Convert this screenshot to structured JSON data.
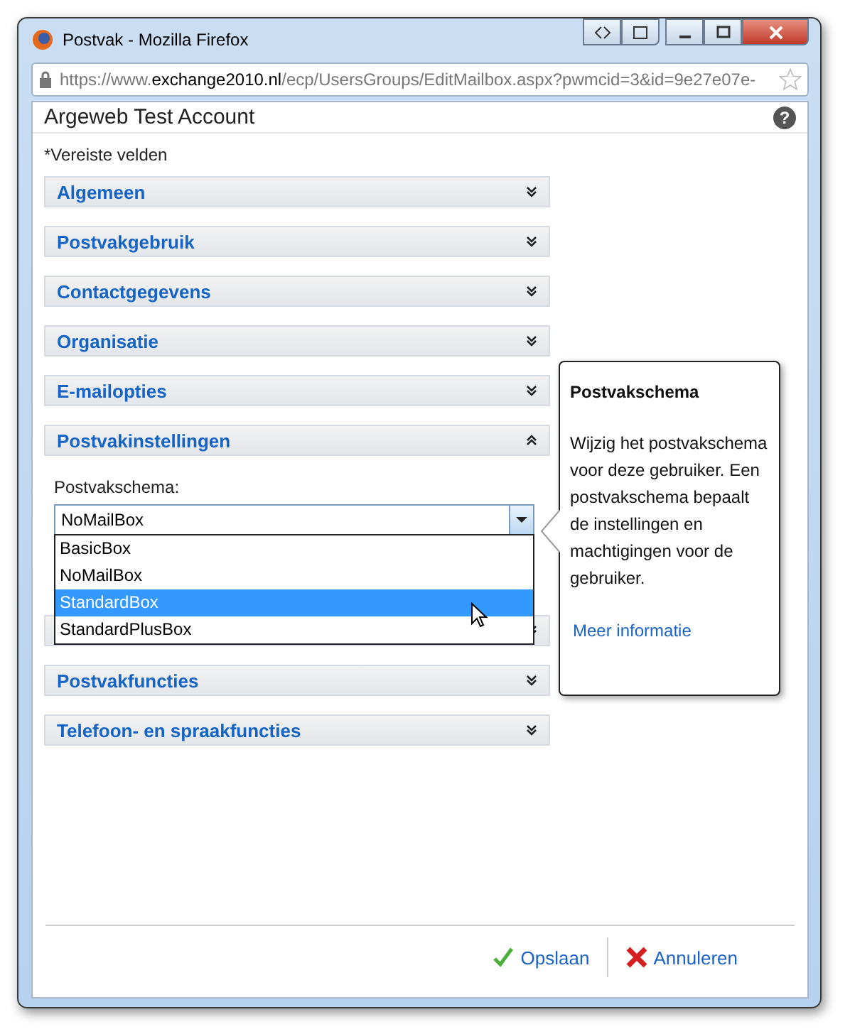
{
  "window": {
    "title": "Postvak - Mozilla Firefox"
  },
  "address_bar": {
    "prefix": "https://www.",
    "domain": "exchange2010.nl",
    "path": "/ecp/UsersGroups/EditMailbox.aspx?pwmcid=3&id=9e27e07e-"
  },
  "page": {
    "title": "Argeweb Test Account",
    "help": "?",
    "required_note": "*Vereiste velden"
  },
  "sections": [
    {
      "title": "Algemeen",
      "expanded": false
    },
    {
      "title": "Postvakgebruik",
      "expanded": false
    },
    {
      "title": "Contactgegevens",
      "expanded": false
    },
    {
      "title": "Organisatie",
      "expanded": false
    },
    {
      "title": "E-mailopties",
      "expanded": false
    },
    {
      "title": "Postvakinstellingen",
      "expanded": true,
      "field": {
        "label": "Postvakschema:",
        "value": "NoMailBox",
        "options": [
          {
            "label": "BasicBox",
            "highlighted": false
          },
          {
            "label": "NoMailBox",
            "highlighted": false
          },
          {
            "label": "StandardBox",
            "highlighted": true
          },
          {
            "label": "StandardPlusBox",
            "highlighted": false
          }
        ]
      }
    },
    {
      "expanded": false
    },
    {
      "title": "Postvakfuncties",
      "expanded": false
    },
    {
      "title": "Telefoon- en spraakfuncties",
      "expanded": false
    }
  ],
  "tooltip": {
    "title": "Postvakschema",
    "body": "Wijzig het postvakschema voor deze gebruiker. Een postvakschema bepaalt de instellingen en machtigingen voor de gebruiker.",
    "link": "Meer informatie"
  },
  "buttons": [
    {
      "kind": "save",
      "label": "Opslaan"
    },
    {
      "kind": "cancel",
      "label": "Annuleren"
    }
  ]
}
